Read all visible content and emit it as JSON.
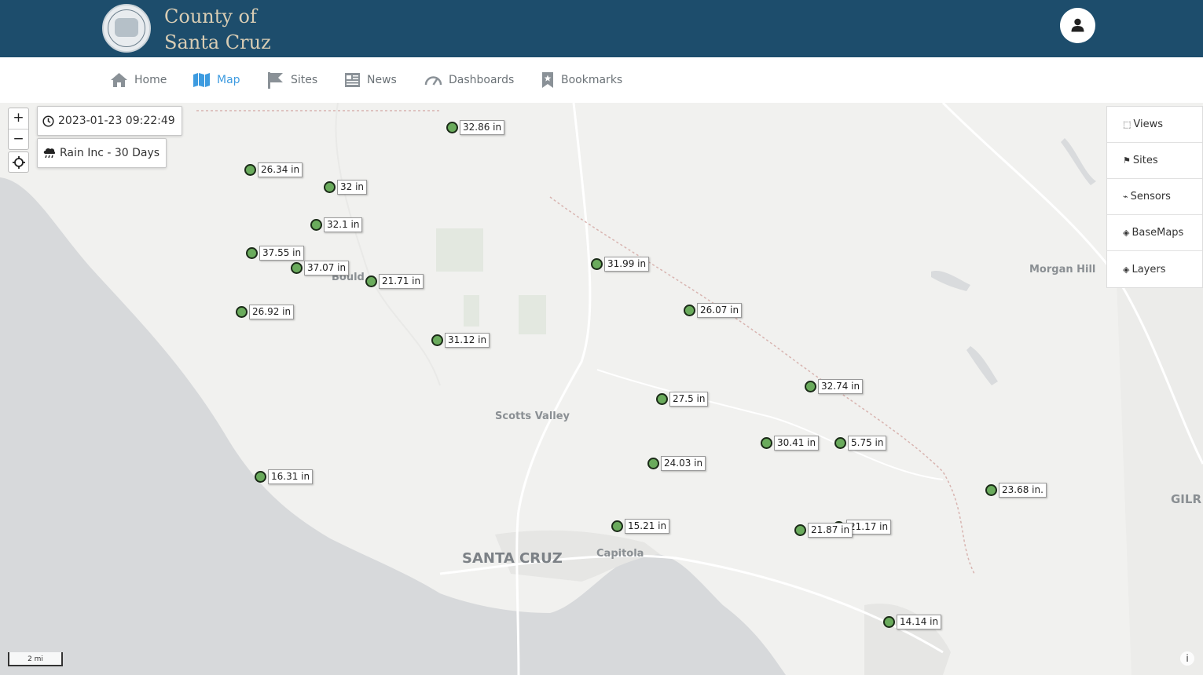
{
  "header": {
    "brand_line1": "County of",
    "brand_line2": "Santa Cruz",
    "seal_text": "THE COUNTY OF SANTA CRUZ 1850",
    "user_icon": "user-icon"
  },
  "nav": {
    "items": [
      {
        "label": "Home",
        "icon": "home-icon"
      },
      {
        "label": "Map",
        "icon": "map-icon",
        "active": true
      },
      {
        "label": "Sites",
        "icon": "flag-icon"
      },
      {
        "label": "News",
        "icon": "newspaper-icon"
      },
      {
        "label": "Dashboards",
        "icon": "gauge-icon"
      },
      {
        "label": "Bookmarks",
        "icon": "bookmark-icon"
      }
    ]
  },
  "map": {
    "zoom_in": "+",
    "zoom_out": "−",
    "timestamp": "2023-01-23 09:22:49",
    "layer_label": "Rain Inc - 30 Days",
    "scale_label": "2 mi",
    "attribution": "i",
    "places": {
      "santa_cruz": "SANTA CRUZ",
      "capitola": "Capitola",
      "scotts_valley": "Scotts Valley",
      "morgan_hill": "Morgan Hill",
      "gilroy": "GILR",
      "boulder": "Bould"
    },
    "panel": {
      "views": "Views",
      "sites": "Sites",
      "sensors": "Sensors",
      "basemaps": "BaseMaps",
      "layers": "Layers"
    },
    "stations": [
      "32.86 in",
      "26.34 in",
      "32 in",
      "32.1 in",
      "37.55 in",
      "37.07 in",
      "21.71 in",
      "26.92 in",
      "31.12 in",
      "31.99 in",
      "26.07 in",
      "32.74 in",
      "27.5 in",
      "30.41 in",
      "5.75 in",
      "24.03 in",
      "16.31 in",
      "23.68 in.",
      "15.21 in",
      "21.87 in",
      "21.17 in",
      "14.14 in"
    ]
  },
  "colors": {
    "header_bg": "#1d4d6c",
    "brand_text": "#d9cdb4",
    "accent": "#3d9be0",
    "marker_fill": "#6aab5c"
  }
}
